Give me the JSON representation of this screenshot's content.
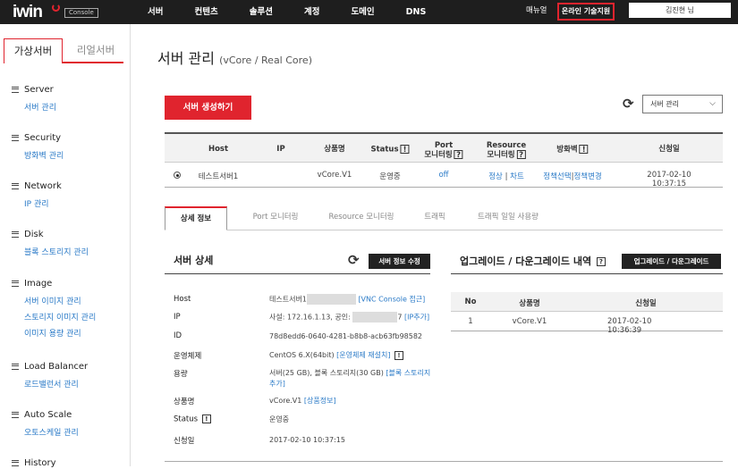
{
  "header": {
    "logo": "iwin",
    "logo_badge": "Console",
    "nav": [
      "서버",
      "컨텐츠",
      "솔루션",
      "계정",
      "도메인",
      "DNS"
    ],
    "manual": "매뉴얼",
    "support": "온라인 기술지원",
    "user": "김진현 님"
  },
  "sidebar": {
    "tab_active": "가상서버",
    "tab_inactive": "리얼서버",
    "groups": [
      {
        "title": "Server",
        "items": [
          "서버 관리"
        ]
      },
      {
        "title": "Security",
        "items": [
          "방화벽 관리"
        ]
      },
      {
        "title": "Network",
        "items": [
          "IP 관리"
        ]
      },
      {
        "title": "Disk",
        "items": [
          "블록 스토리지 관리"
        ]
      },
      {
        "title": "Image",
        "items": [
          "서버 이미지 관리",
          "스토리지 이미지 관리",
          "이미지 용량 관리"
        ]
      },
      {
        "title": "Load Balancer",
        "items": [
          "로드밸런서 관리"
        ]
      },
      {
        "title": "Auto Scale",
        "items": [
          "오토스케일 관리"
        ]
      },
      {
        "title": "History",
        "items": []
      }
    ]
  },
  "main": {
    "title": "서버 관리",
    "title_sub": "(vCore / Real Core)",
    "create_button": "서버 생성하기",
    "select_value": "서버 관리",
    "server_table": {
      "headers": {
        "host": "Host",
        "ip": "IP",
        "product": "상품명",
        "status": "Status",
        "port": "Port",
        "port2": "모니터링",
        "resource": "Resource",
        "resource2": "모니터링",
        "firewall": "방화벽",
        "date": "신청일"
      },
      "row": {
        "host": "테스트서버1",
        "product": "vCore.V1",
        "status": "운영중",
        "port": "off",
        "res_a": "정상",
        "res_sep": "|",
        "res_b": "차트",
        "fw_a": "정책선택",
        "fw_sep": "|",
        "fw_b": "정책변경",
        "date": "2017-02-10 10:37:15"
      }
    },
    "detail_tabs": [
      "상세 정보",
      "Port 모니터링",
      "Resource 모니터링",
      "트래픽",
      "트래픽 일일 사용량"
    ],
    "detail": {
      "title": "서버 상세",
      "edit_button": "서버 정보 수정",
      "labels": {
        "host": "Host",
        "ip": "IP",
        "id": "ID",
        "os": "운영체제",
        "capacity": "용량",
        "product": "상품명",
        "status": "Status",
        "date": "신청일"
      },
      "host_value": "테스트서버1",
      "host_link": "[VNC Console 접근]",
      "ip_prefix": "사설: 172.16.1.13, 공인:",
      "ip_suffix": "7",
      "ip_link": "[IP추가]",
      "id_value": "78d8edd6-0640-4281-b8b8-acb63fb98582",
      "os_value": "CentOS 6.X(64bit)",
      "os_link": "[운영체제 재설치]",
      "capacity_value": "서버(25 GB), 블록 스토리지(30 GB)",
      "capacity_link1": "[블록 스토리지",
      "capacity_link2": "추가]",
      "product_value": "vCore.V1",
      "product_link": "[상품정보]",
      "status_value": "운영중",
      "date_value": "2017-02-10 10:37:15"
    },
    "upgrade": {
      "title": "업그레이드 / 다운그레이드 내역",
      "button": "업그레이드 / 다운그레이드",
      "headers": [
        "No",
        "상품명",
        "신청일"
      ],
      "row": [
        "1",
        "vCore.V1",
        "2017-02-10 10:36:39"
      ]
    }
  }
}
